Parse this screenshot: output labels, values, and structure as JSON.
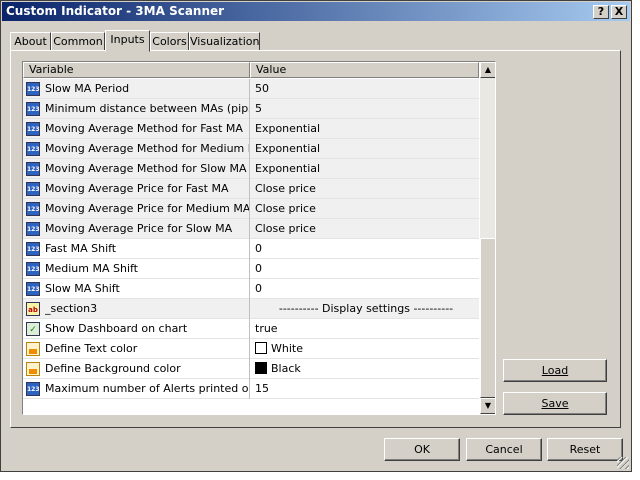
{
  "window": {
    "title": "Custom Indicator - 3MA Scanner",
    "help_btn": "?",
    "close_btn": "X"
  },
  "tabs": [
    "About",
    "Common",
    "Inputs",
    "Colors",
    "Visualization"
  ],
  "active_tab": "Inputs",
  "grid": {
    "col_variable": "Variable",
    "col_value": "Value",
    "rows": [
      {
        "icon": "num",
        "name": "Slow MA Period",
        "value": "50"
      },
      {
        "icon": "num",
        "name": "Minimum distance between MAs (pips)",
        "value": "5"
      },
      {
        "icon": "num",
        "name": "Moving Average Method for Fast MA",
        "value": "Exponential"
      },
      {
        "icon": "num",
        "name": "Moving Average Method for Medium MA",
        "value": "Exponential"
      },
      {
        "icon": "num",
        "name": "Moving Average Method for Slow MA",
        "value": "Exponential"
      },
      {
        "icon": "num",
        "name": "Moving Average Price for Fast MA",
        "value": "Close price"
      },
      {
        "icon": "num",
        "name": "Moving Average Price for Medium MA",
        "value": "Close price"
      },
      {
        "icon": "num",
        "name": "Moving Average Price for Slow MA",
        "value": "Close price"
      },
      {
        "icon": "num",
        "name": "Fast MA Shift",
        "value": "0"
      },
      {
        "icon": "num",
        "name": "Medium MA Shift",
        "value": "0"
      },
      {
        "icon": "num",
        "name": "Slow MA Shift",
        "value": "0"
      },
      {
        "icon": "str",
        "name": "_section3",
        "value": "---------- Display settings ----------"
      },
      {
        "icon": "bool",
        "name": "Show Dashboard on chart",
        "value": "true"
      },
      {
        "icon": "color",
        "name": "Define Text color",
        "value": "White",
        "swatch": "#ffffff"
      },
      {
        "icon": "color",
        "name": "Define Background color",
        "value": "Black",
        "swatch": "#000000"
      },
      {
        "icon": "num",
        "name": "Maximum number of Alerts printed on Chart",
        "value": "15"
      }
    ]
  },
  "icons": {
    "num": "123",
    "str": "ab",
    "bool": "✓"
  },
  "buttons": {
    "load": "Load",
    "save": "Save",
    "ok": "OK",
    "cancel": "Cancel",
    "reset": "Reset"
  }
}
